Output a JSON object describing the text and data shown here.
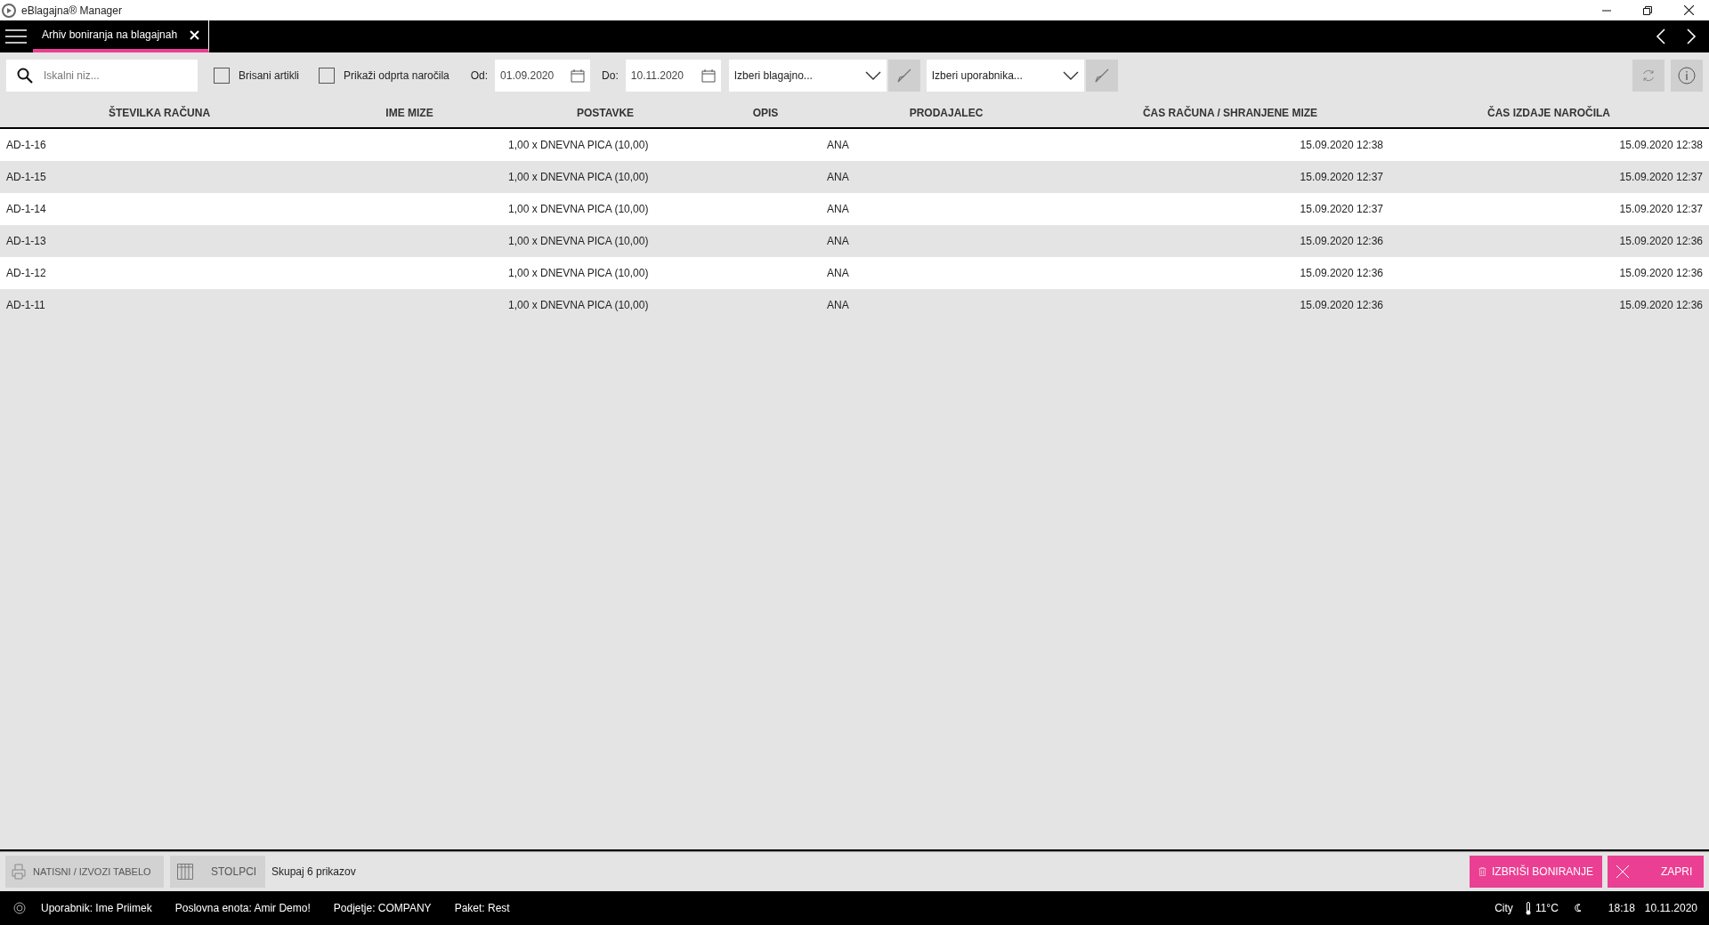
{
  "window": {
    "title": "eBlagajna® Manager"
  },
  "tabs": [
    {
      "label": "Arhiv boniranja na blagajnah",
      "selected": true
    }
  ],
  "toolbar": {
    "search": {
      "placeholder": "Iskalni niz..."
    },
    "checkboxes": [
      {
        "label": "Brisani artikli",
        "checked": false
      },
      {
        "label": "Prikaži odprta naročila",
        "checked": false
      }
    ],
    "date_from": {
      "label": "Od:",
      "value": "01.09.2020"
    },
    "date_to": {
      "label": "Do:",
      "value": "10.11.2020"
    },
    "dropdowns": [
      {
        "placeholder": "Izberi blagajno..."
      },
      {
        "placeholder": "Izberi uporabnika..."
      }
    ]
  },
  "table": {
    "columns": [
      "ŠTEVILKA RAČUNA",
      "IME MIZE",
      "POSTAVKE",
      "OPIS",
      "PRODAJALEC",
      "ČAS RAČUNA / SHRANJENE MIZE",
      "ČAS IZDAJE NAROČILA"
    ],
    "rows": [
      {
        "number": "AD-1-16",
        "items": "1,00 x DNEVNA PICA (10,00)",
        "seller": "ANA",
        "bill_time": "15.09.2020 12:38",
        "order_time": "15.09.2020 12:38"
      },
      {
        "number": "AD-1-15",
        "items": "1,00 x DNEVNA PICA (10,00)",
        "seller": "ANA",
        "bill_time": "15.09.2020 12:37",
        "order_time": "15.09.2020 12:37"
      },
      {
        "number": "AD-1-14",
        "items": "1,00 x DNEVNA PICA (10,00)",
        "seller": "ANA",
        "bill_time": "15.09.2020 12:37",
        "order_time": "15.09.2020 12:37"
      },
      {
        "number": "AD-1-13",
        "items": "1,00 x DNEVNA PICA (10,00)",
        "seller": "ANA",
        "bill_time": "15.09.2020 12:36",
        "order_time": "15.09.2020 12:36"
      },
      {
        "number": "AD-1-12",
        "items": "1,00 x DNEVNA PICA (10,00)",
        "seller": "ANA",
        "bill_time": "15.09.2020 12:36",
        "order_time": "15.09.2020 12:36"
      },
      {
        "number": "AD-1-11",
        "items": "1,00 x DNEVNA PICA (10,00)",
        "seller": "ANA",
        "bill_time": "15.09.2020 12:36",
        "order_time": "15.09.2020 12:36"
      }
    ]
  },
  "footer": {
    "print_button": "NATISNI / IZVOZI TABELO",
    "columns_button": "STOLPCI",
    "total": "Skupaj 6 prikazov",
    "delete_button": "IZBRIŠI BONIRANJE",
    "close_button": "ZAPRI"
  },
  "status_bar": {
    "items": [
      "Uporabnik: Ime Priimek",
      "Poslovna enota: Amir Demo!",
      "Podjetje: COMPANY",
      "Paket: Rest"
    ],
    "city": "City",
    "temperature": "11°C",
    "time": "18:18",
    "date": "10.11.2020"
  }
}
